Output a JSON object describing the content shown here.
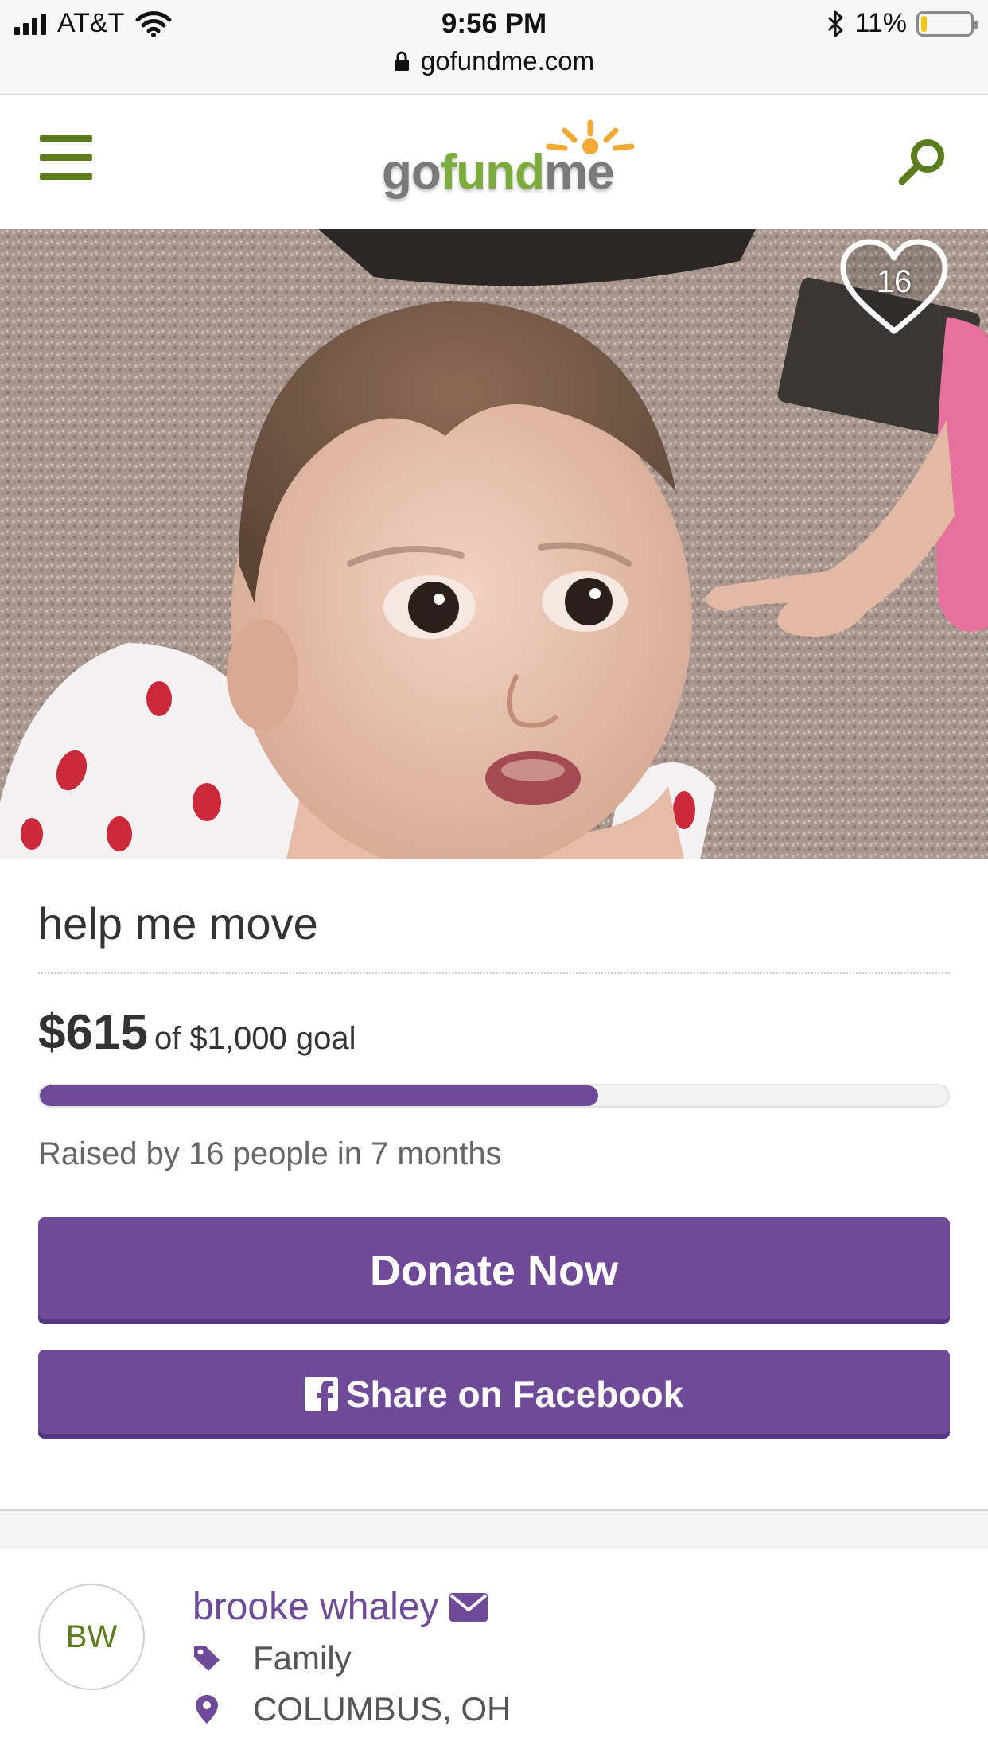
{
  "status_bar": {
    "carrier": "AT&T",
    "time": "9:56 PM",
    "battery_pct": "11%",
    "battery_level": 0.11,
    "url": "gofundme.com"
  },
  "header": {
    "logo_go": "go",
    "logo_fund": "fund",
    "logo_me": "me"
  },
  "hero": {
    "heart_count": "16"
  },
  "campaign": {
    "title": "help me move",
    "amount": "$615",
    "goal": "of $1,000 goal",
    "progress_fraction": 0.615,
    "raised_text": "Raised by 16 people in 7 months",
    "donate_label": "Donate Now",
    "share_label": "Share on Facebook"
  },
  "organizer": {
    "initials": "BW",
    "name": "brooke whaley",
    "category": "Family",
    "location": "COLUMBUS, OH"
  },
  "colors": {
    "brand_purple": "#6e4a98",
    "brand_green": "#5b7d1e",
    "logo_green": "#7cad3c"
  },
  "icons": [
    "signal-icon",
    "wifi-icon",
    "bluetooth-icon",
    "battery-icon",
    "lock-icon",
    "menu-icon",
    "search-icon",
    "heart-icon",
    "facebook-icon",
    "mail-icon",
    "tag-icon",
    "location-pin-icon"
  ]
}
